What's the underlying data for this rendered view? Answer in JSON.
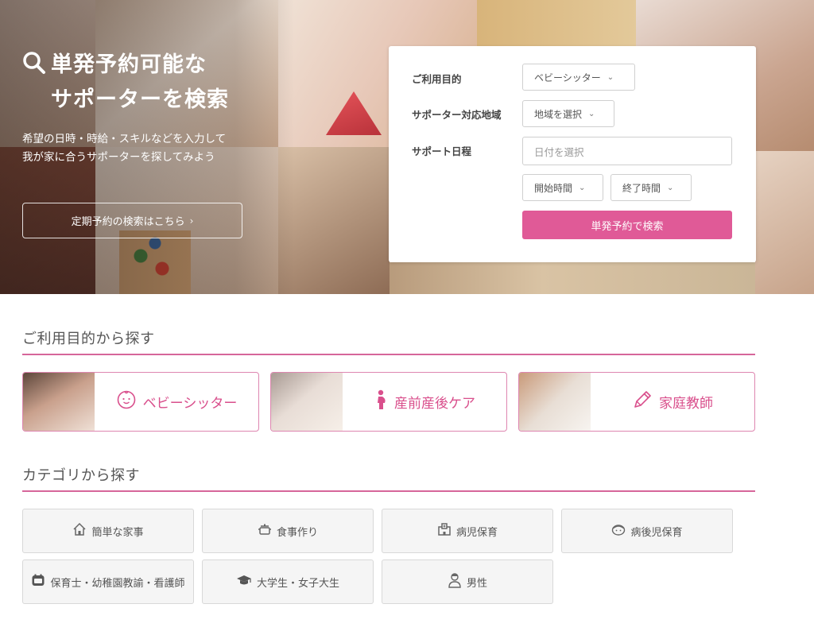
{
  "hero": {
    "title_line1": "単発予約可能な",
    "title_line2": "サポーターを検索",
    "description": "希望の日時・時給・スキルなどを入力して我が家に合うサポーターを探してみよう",
    "regular_link": "定期予約の検索はこちら",
    "chevron": "›"
  },
  "search_form": {
    "purpose_label": "ご利用目的",
    "purpose_value": "ベビーシッター",
    "area_label": "サポーター対応地域",
    "area_value": "地域を選択",
    "schedule_label": "サポート日程",
    "date_placeholder": "日付を選択",
    "start_time": "開始時間",
    "end_time": "終了時間",
    "search_button": "単発予約で検索",
    "caret": "⌄"
  },
  "purpose_section": {
    "title": "ご利用目的から探す",
    "cards": [
      {
        "label": "ベビーシッター",
        "icon": "baby-face-icon"
      },
      {
        "label": "産前産後ケア",
        "icon": "pregnant-icon"
      },
      {
        "label": "家庭教師",
        "icon": "pencil-icon"
      }
    ]
  },
  "category_section": {
    "title": "カテゴリから探す",
    "items": [
      {
        "label": "簡単な家事",
        "icon": "house-icon"
      },
      {
        "label": "食事作り",
        "icon": "pot-icon"
      },
      {
        "label": "病児保育",
        "icon": "hospital-icon"
      },
      {
        "label": "病後児保育",
        "icon": "baby-icon"
      },
      {
        "label": "保育士・幼稚園教諭・看護師",
        "icon": "calendar-badge-icon"
      },
      {
        "label": "大学生・女子大生",
        "icon": "graduation-cap-icon"
      },
      {
        "label": "男性",
        "icon": "man-icon"
      }
    ]
  },
  "colors": {
    "accent": "#e05a97",
    "accent_text": "#d94f8c",
    "rule": "#d6669a",
    "category_bg": "#f5f5f5"
  }
}
